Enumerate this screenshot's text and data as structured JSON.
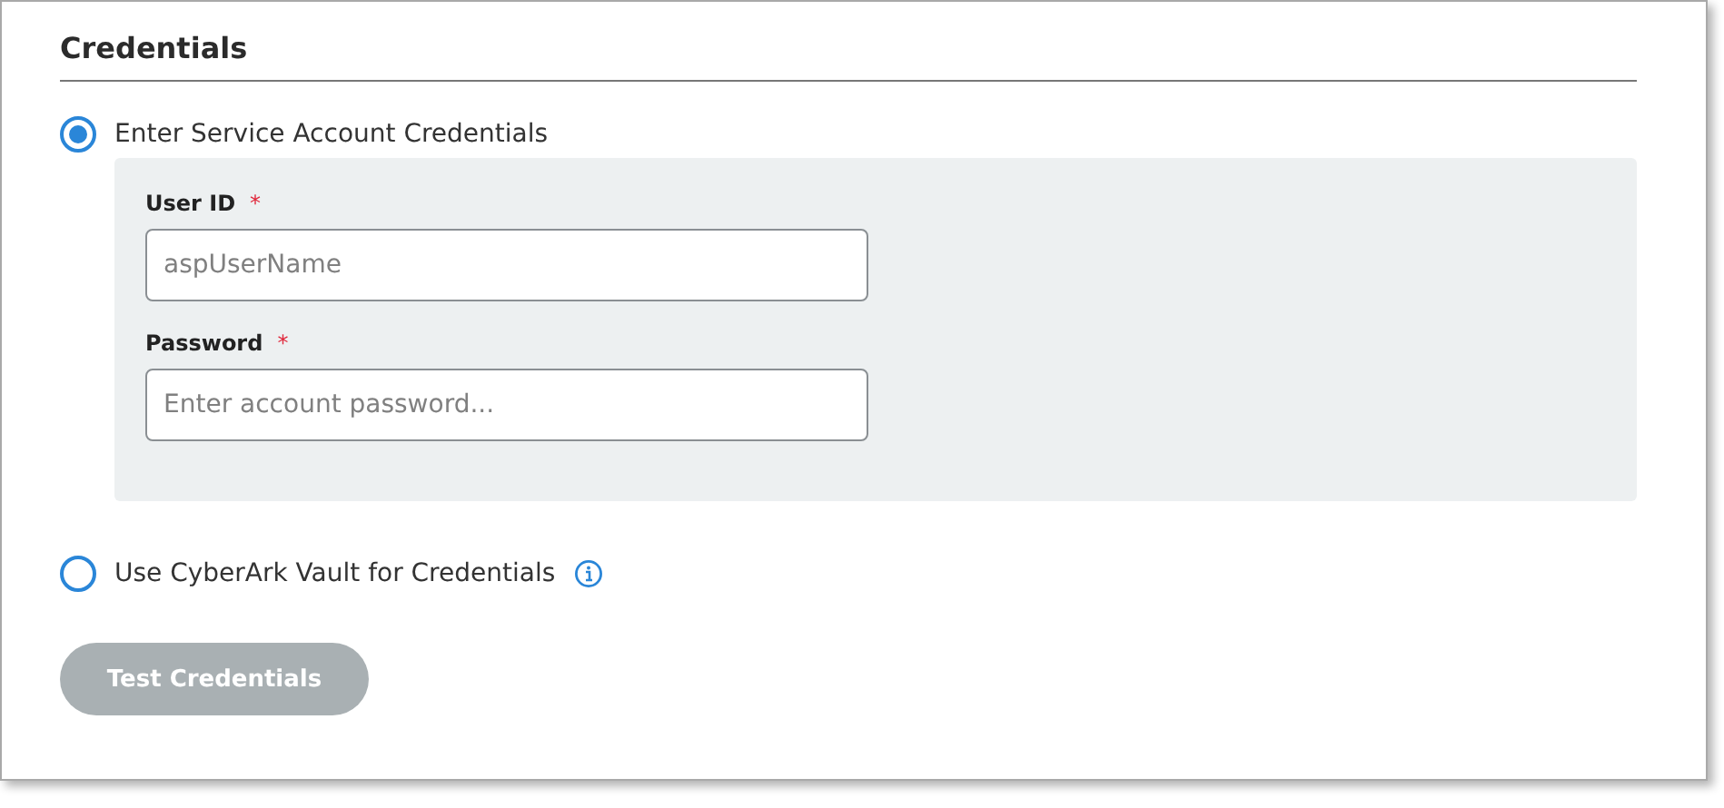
{
  "section": {
    "title": "Credentials"
  },
  "options": [
    {
      "label": "Enter Service Account Credentials",
      "selected": true,
      "info": false,
      "fields": [
        {
          "label": "User ID",
          "required_mark": "*",
          "placeholder": "aspUserName"
        },
        {
          "label": "Password",
          "required_mark": "*",
          "placeholder": "Enter account password..."
        }
      ]
    },
    {
      "label": "Use CyberArk Vault for Credentials",
      "selected": false,
      "info": true
    }
  ],
  "button": {
    "label": "Test Credentials",
    "disabled": true
  }
}
